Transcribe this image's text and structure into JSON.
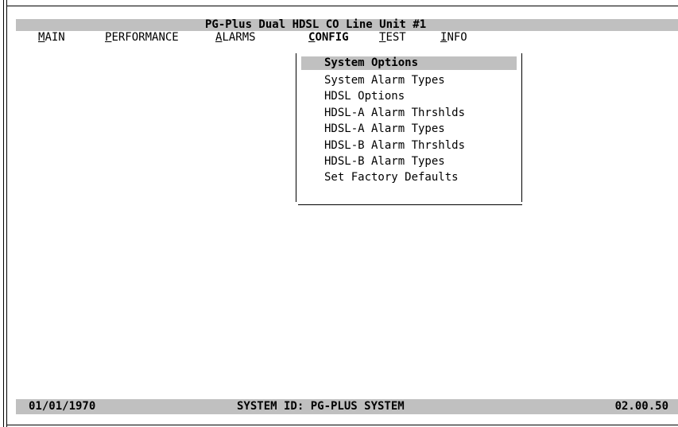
{
  "window": {
    "title": "PG-Plus Dual HDSL CO Line Unit #1"
  },
  "menu": {
    "items": [
      {
        "hotkey": "M",
        "rest": "AIN",
        "active": false
      },
      {
        "hotkey": "P",
        "rest": "ERFORMANCE",
        "active": false
      },
      {
        "hotkey": "A",
        "rest": "LARMS",
        "active": false
      },
      {
        "hotkey": "C",
        "rest": "ONFIG",
        "active": true
      },
      {
        "hotkey": "T",
        "rest": "EST",
        "active": false
      },
      {
        "hotkey": "I",
        "rest": "NFO",
        "active": false
      }
    ]
  },
  "config_dropdown": {
    "items": [
      {
        "label": "System Options",
        "selected": true
      },
      {
        "label": "System Alarm Types",
        "selected": false
      },
      {
        "label": "HDSL Options",
        "selected": false
      },
      {
        "label": "HDSL-A Alarm Thrshlds",
        "selected": false
      },
      {
        "label": "HDSL-A Alarm Types",
        "selected": false
      },
      {
        "label": "HDSL-B Alarm Thrshlds",
        "selected": false
      },
      {
        "label": "HDSL-B Alarm Types",
        "selected": false
      },
      {
        "label": "Set Factory Defaults",
        "selected": false
      }
    ]
  },
  "status": {
    "date": "01/01/1970",
    "system_id": "SYSTEM ID: PG-PLUS SYSTEM",
    "time": "02.00.50"
  },
  "colors": {
    "bar_gray": "#c0c0c0",
    "background": "#ffffff",
    "text": "#000000"
  }
}
